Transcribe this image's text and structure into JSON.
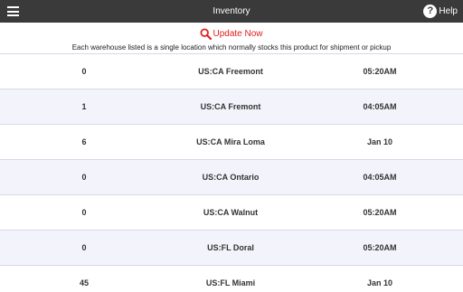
{
  "header": {
    "title": "Inventory",
    "help_label": "Help",
    "help_glyph": "?"
  },
  "update": {
    "label": "Update Now",
    "icon": "search-icon",
    "color": "#e02020"
  },
  "note": "Each warehouse listed is a single location which normally stocks this product for shipment or pickup",
  "rows": [
    {
      "qty": "0",
      "location": "US:CA Freemont",
      "time": "05:20AM"
    },
    {
      "qty": "1",
      "location": "US:CA Fremont",
      "time": "04:05AM"
    },
    {
      "qty": "6",
      "location": "US:CA Mira Loma",
      "time": "Jan 10"
    },
    {
      "qty": "0",
      "location": "US:CA Ontario",
      "time": "04:05AM"
    },
    {
      "qty": "0",
      "location": "US:CA Walnut",
      "time": "05:20AM"
    },
    {
      "qty": "0",
      "location": "US:FL Doral",
      "time": "05:20AM"
    },
    {
      "qty": "45",
      "location": "US:FL Miami",
      "time": "Jan 10"
    }
  ]
}
